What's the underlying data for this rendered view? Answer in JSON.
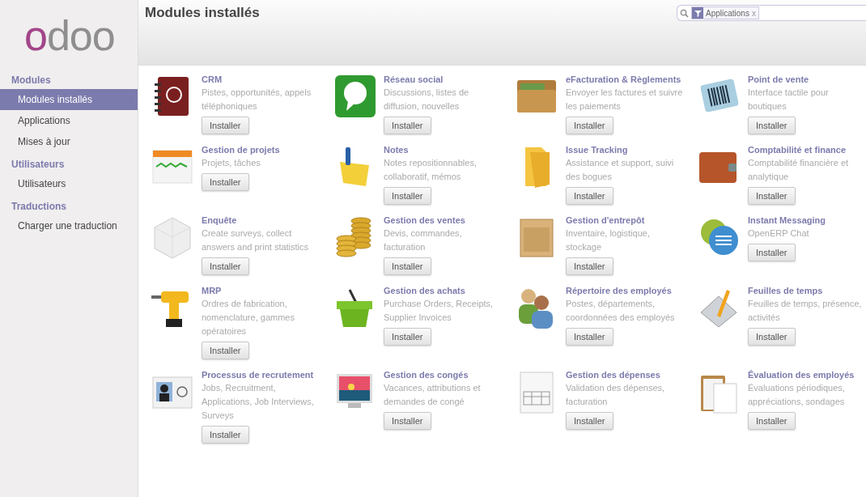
{
  "logo": "odoo",
  "sidebar": {
    "sections": [
      {
        "title": "Modules",
        "items": [
          {
            "label": "Modules installés",
            "selected": true
          },
          {
            "label": "Applications",
            "selected": false
          },
          {
            "label": "Mises à jour",
            "selected": false
          }
        ]
      },
      {
        "title": "Utilisateurs",
        "items": [
          {
            "label": "Utilisateurs",
            "selected": false
          }
        ]
      },
      {
        "title": "Traductions",
        "items": [
          {
            "label": "Charger une traduction",
            "selected": false
          }
        ]
      }
    ]
  },
  "header": {
    "title": "Modules installés",
    "search": {
      "facet": "Applications",
      "facet_remove": "x"
    }
  },
  "modules": [
    {
      "name": "CRM",
      "description": "Pistes, opportunités, appels téléphoniques",
      "button": "Installer"
    },
    {
      "name": "Réseau social",
      "description": "Discussions, listes de diffusion, nouvelles",
      "button": "Installer"
    },
    {
      "name": "eFacturation & Règlements",
      "description": "Envoyer les factures et suivre les paiements",
      "button": "Installer"
    },
    {
      "name": "Point de vente",
      "description": "Interface tactile pour boutiques",
      "button": "Installer"
    },
    {
      "name": "Gestion de projets",
      "description": "Projets, tâches",
      "button": "Installer"
    },
    {
      "name": "Notes",
      "description": "Notes repositionnables, collaboratif, mémos",
      "button": "Installer"
    },
    {
      "name": "Issue Tracking",
      "description": "Assistance et support, suivi des bogues",
      "button": "Installer"
    },
    {
      "name": "Comptabilité et finance",
      "description": "Comptabilité financière et analytique",
      "button": "Installer"
    },
    {
      "name": "Enquête",
      "description": "Create surveys, collect answers and print statistics",
      "button": "Installer"
    },
    {
      "name": "Gestion des ventes",
      "description": "Devis, commandes, facturation",
      "button": "Installer"
    },
    {
      "name": "Gestion d'entrepôt",
      "description": "Inventaire, logistique, stockage",
      "button": "Installer"
    },
    {
      "name": "Instant Messaging",
      "description": "OpenERP Chat",
      "button": "Installer"
    },
    {
      "name": "MRP",
      "description": "Ordres de fabrication, nomenclature, gammes opératoires",
      "button": "Installer"
    },
    {
      "name": "Gestion des achats",
      "description": "Purchase Orders, Receipts, Supplier Invoices",
      "button": "Installer"
    },
    {
      "name": "Répertoire des employés",
      "description": "Postes, départements, coordonnées des employés",
      "button": "Installer"
    },
    {
      "name": "Feuilles de temps",
      "description": "Feuilles de temps, présence, activités",
      "button": "Installer"
    },
    {
      "name": "Processus de recrutement",
      "description": "Jobs, Recruitment, Applications, Job Interviews, Surveys",
      "button": "Installer"
    },
    {
      "name": "Gestion des congés",
      "description": "Vacances, attributions et demandes de congé",
      "button": "Installer"
    },
    {
      "name": "Gestion des dépenses",
      "description": "Validation des dépenses, facturation",
      "button": "Installer"
    },
    {
      "name": "Évaluation des employés",
      "description": "Évaluations périodiques, appréciations, sondages",
      "button": "Installer"
    }
  ]
}
